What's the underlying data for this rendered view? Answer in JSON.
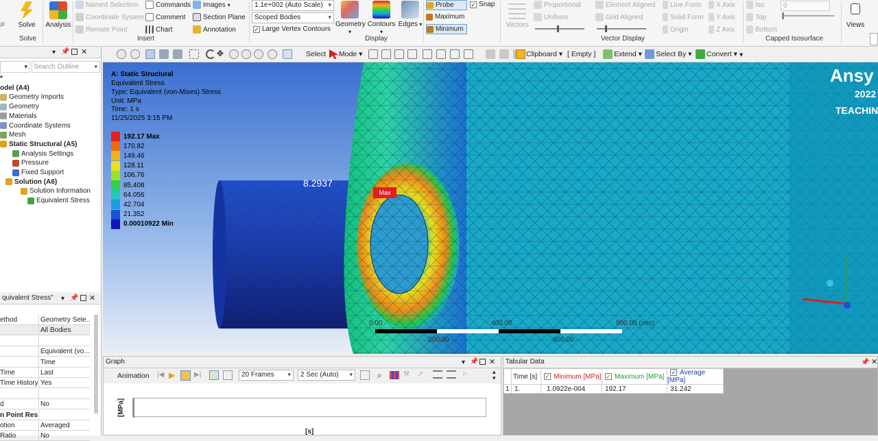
{
  "ribbon": {
    "solve": {
      "label": "Solve",
      "group": "Solve"
    },
    "analysis": "Analysis",
    "insert": {
      "named_selection": "Named Selection",
      "coordinate_system": "Coordinate System",
      "remote_point": "Remote Point",
      "commands": "Commands",
      "comment": "Comment",
      "chart": "Chart",
      "images": "Images",
      "section_plane": "Section Plane",
      "annotation": "Annotation",
      "group": "Insert"
    },
    "display": {
      "scale": "1.1e+002 (Auto Scale)",
      "scope": "Scoped Bodies",
      "large_vertex": "Large Vertex Contours",
      "geometry": "Geometry",
      "contours": "Contours",
      "edges": "Edges",
      "group": "Display"
    },
    "probe": {
      "probe": "Probe",
      "snap": "Snap",
      "maximum": "Maximum",
      "minimum": "Minimum"
    },
    "vector_display": {
      "vectors": "Vectors",
      "proportional": "Proportional",
      "uniform": "Uniform",
      "element_aligned": "Element Aligned",
      "grid_aligned": "Grid Aligned",
      "line_form": "Line Form",
      "solid_form": "Solid Form",
      "origin": "Origin",
      "x_axis": "X Axis",
      "y_axis": "Y Axis",
      "z_axis": "Z Axis",
      "group": "Vector Display"
    },
    "capped": {
      "iso": "Iso",
      "top": "Top",
      "bottom": "Bottom",
      "value": "0",
      "group": "Capped Isosurface"
    },
    "views": "Views"
  },
  "toolbar": {
    "select": "Select",
    "mode": "Mode",
    "clipboard": "Clipboard",
    "empty": "[ Empty ]",
    "extend": "Extend",
    "select_by": "Select By",
    "convert": "Convert"
  },
  "outline": {
    "search_placeholder": "Search Outline",
    "items": [
      {
        "label": "*",
        "bold": true
      },
      {
        "label": "odel (A4)",
        "bold": true
      },
      {
        "label": "Geometry Imports",
        "bold": false
      },
      {
        "label": "Geometry",
        "bold": false
      },
      {
        "label": "Materials",
        "bold": false
      },
      {
        "label": "Coordinate Systems",
        "bold": false
      },
      {
        "label": "Mesh",
        "bold": false
      },
      {
        "label": "Static Structural (A5)",
        "bold": true
      },
      {
        "label": "Analysis Settings",
        "bold": false
      },
      {
        "label": "Pressure",
        "bold": false
      },
      {
        "label": "Fixed Support",
        "bold": false
      },
      {
        "label": "Solution (A6)",
        "bold": true
      },
      {
        "label": "Solution Information",
        "bold": false
      },
      {
        "label": "Equivalent Stress",
        "bold": false
      }
    ]
  },
  "details": {
    "title": "quivalent Stress\"",
    "rows": [
      {
        "k": "ethod",
        "v": "Geometry Sele..."
      },
      {
        "k": "",
        "v": "All Bodies"
      },
      {
        "k": "",
        "v": ""
      },
      {
        "k": "",
        "v": "Equivalent (vo..."
      },
      {
        "k": "",
        "v": "Time"
      },
      {
        "k": "Time",
        "v": "Last"
      },
      {
        "k": "Time History",
        "v": "Yes"
      },
      {
        "k": "",
        "v": ""
      },
      {
        "k": "d",
        "v": "No"
      },
      {
        "k": "n Point Results",
        "v": ""
      },
      {
        "k": "otion",
        "v": "Averaged"
      },
      {
        "k": "Ratio",
        "v": "No"
      }
    ]
  },
  "viewport": {
    "title": "A: Static Structural",
    "lines": [
      "Equivalent Stress",
      "Type: Equivalent (von-Mises) Stress",
      "Unit: MPa",
      "Time: 1 s",
      "11/25/2025 3:15 PM"
    ],
    "legend": [
      {
        "label": "192.17 Max",
        "color": "#e8201a",
        "bold": true
      },
      {
        "label": "170.82",
        "color": "#f06a10",
        "bold": false
      },
      {
        "label": "149.46",
        "color": "#f3b21a",
        "bold": false
      },
      {
        "label": "128.11",
        "color": "#e9e41d",
        "bold": false
      },
      {
        "label": "106.76",
        "color": "#9be12a",
        "bold": false
      },
      {
        "label": "85.408",
        "color": "#33d04a",
        "bold": false
      },
      {
        "label": "64.056",
        "color": "#20c9b8",
        "bold": false
      },
      {
        "label": "42.704",
        "color": "#1a9de0",
        "bold": false
      },
      {
        "label": "21.352",
        "color": "#1452d6",
        "bold": false
      },
      {
        "label": "0.00010922 Min",
        "color": "#1414b8",
        "bold": true
      }
    ],
    "probe_value": "8.2937",
    "max_tag": "Max",
    "brand": "Ansy",
    "year": "2022",
    "teaching": "TEACHIN",
    "scale_labels": [
      "0.00",
      "400.00",
      "800.00 (mm)",
      "200.00",
      "600.00"
    ]
  },
  "graph": {
    "title": "Graph",
    "animation": "Animation",
    "frames": "20 Frames",
    "duration": "2 Sec (Auto)",
    "ylabel": "[MPa]",
    "xlabel": "[s]"
  },
  "tabular": {
    "title": "Tabular Data",
    "headers": [
      "Time [s]",
      "Minimum [MPa]",
      "Maximum [MPa]",
      "Average [MPa]"
    ],
    "row": {
      "idx": "1",
      "time": "1.",
      "min": "1.0922e-004",
      "max": "192.17",
      "avg": "31.242"
    }
  },
  "colors": {
    "panel_bg": "#f0f0f0",
    "max_red": "#e8201a"
  }
}
